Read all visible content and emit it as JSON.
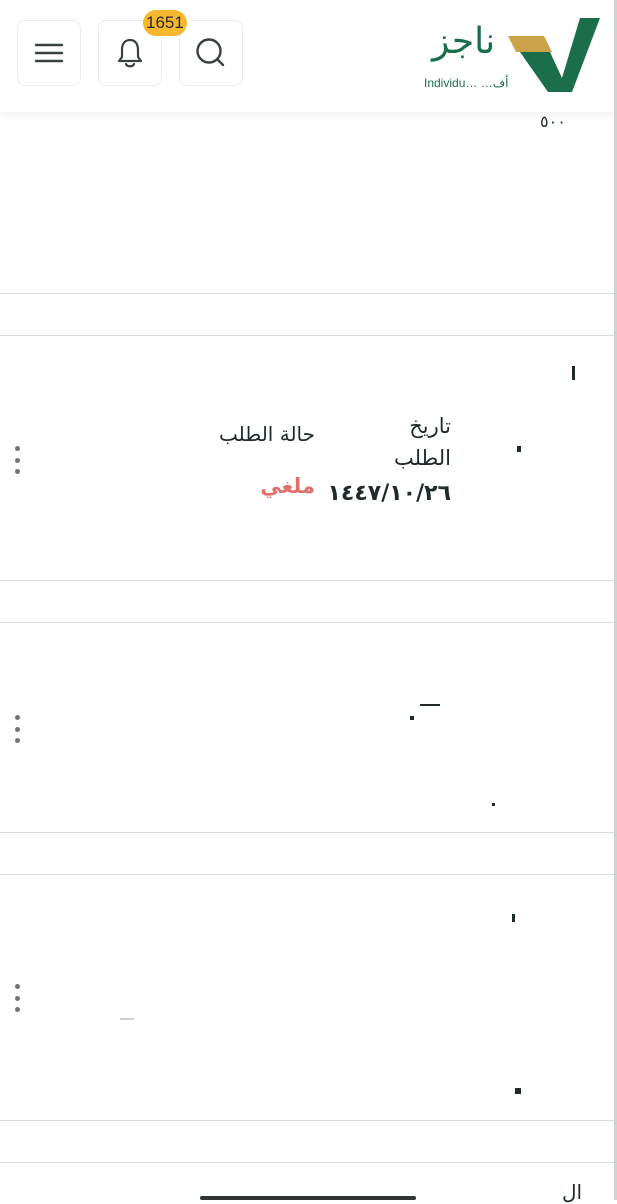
{
  "header": {
    "notification_count": "1651",
    "logo_text": "ناجز",
    "logo_subtitle": "Individu… …أف",
    "icons": [
      "menu-icon",
      "bell-icon",
      "search-icon"
    ],
    "partial_text": "٥٠٠"
  },
  "request": {
    "status_label": "حالة الطلب",
    "status_value": "ملغي",
    "date_label": "تاريخ الطلب",
    "date_value": "١٤٤٧/١٠/٢٦"
  },
  "footer_fragment": "ال",
  "colors": {
    "brand_green": "#1b6e4a",
    "brand_gold": "#c9a24a",
    "badge": "#f5b82e",
    "status_cancelled": "#e0706b"
  }
}
